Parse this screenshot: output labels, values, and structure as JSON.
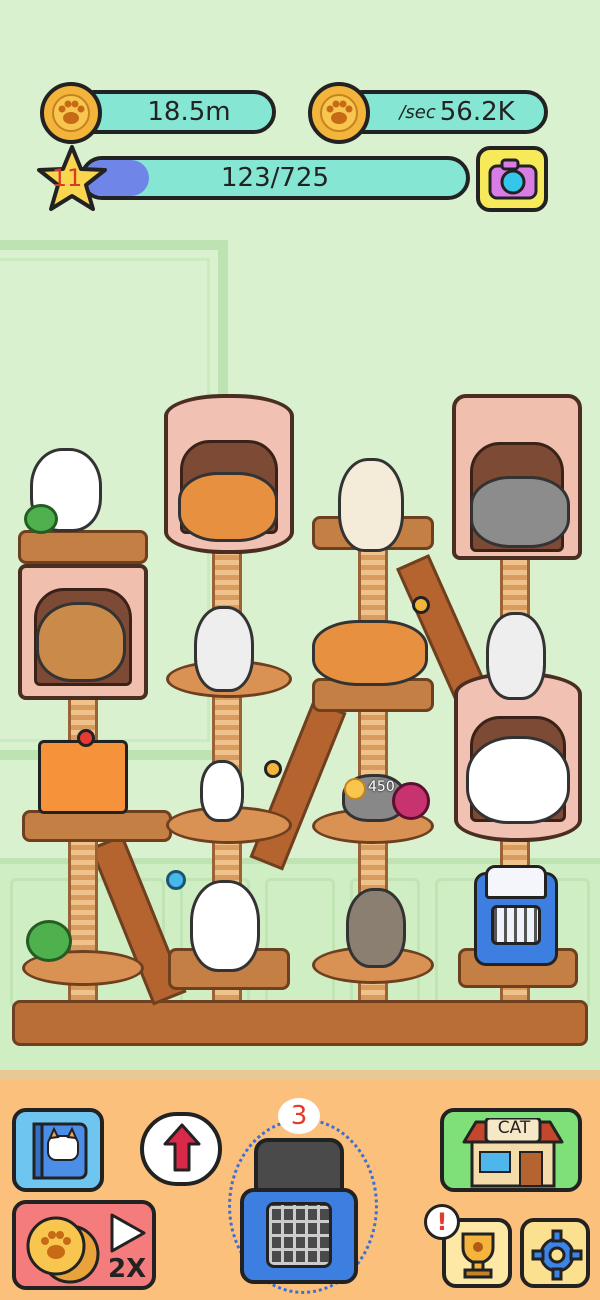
{
  "hud": {
    "coins": "18.5m",
    "per_sec_label": "/sec",
    "per_sec_value": "56.2K",
    "level": "11",
    "progress_text": "123/725",
    "progress_fraction": 0.17
  },
  "tree": {
    "floating_coin_value": "450"
  },
  "bottom": {
    "carrier_badge": "3",
    "ad_multiplier": "2X",
    "shop_sign": "CAT",
    "alert_mark": "!"
  },
  "icons": {
    "coins": "paw-coin-icon",
    "income": "paw-coin-icon",
    "level": "star-icon",
    "camera": "camera-icon",
    "catalog": "cat-book-icon",
    "upgrade": "up-arrow-icon",
    "carrier": "cat-carrier-icon",
    "shop": "cat-shop-icon",
    "trophy": "trophy-icon",
    "settings": "gear-icon",
    "ad": "play-icon"
  },
  "colors": {
    "background": "#d9f1cf",
    "pill": "#86e6d4",
    "progress_fill": "#6f86e8",
    "bottom_bar": "#fbc07b",
    "button_blue": "#6ec6f0",
    "button_red": "#f47c7c",
    "button_green": "#7fe07a"
  }
}
